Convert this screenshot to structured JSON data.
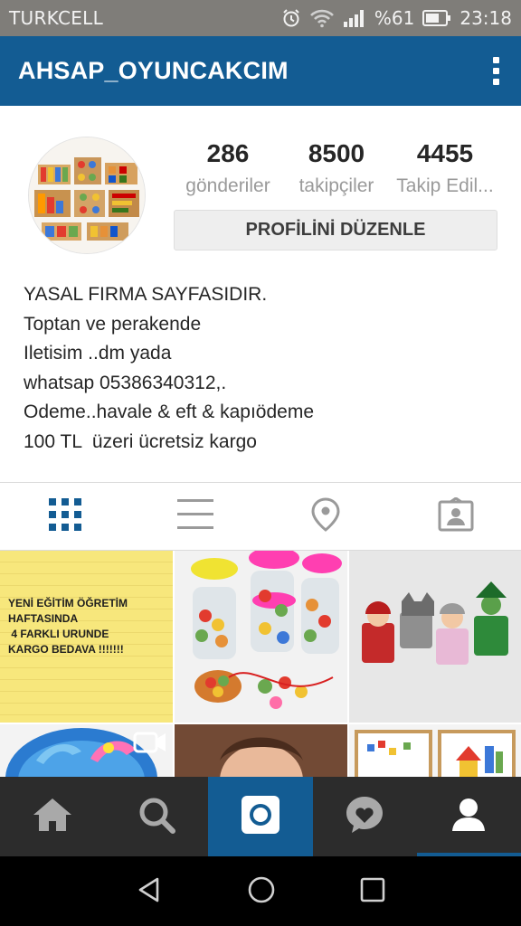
{
  "status_bar": {
    "carrier": "TURKCELL",
    "battery": "%61",
    "time": "23:18",
    "icons": [
      "alarm-icon",
      "wifi-icon",
      "signal-icon",
      "battery-icon"
    ]
  },
  "app_bar": {
    "title": "AHSAP_OYUNCAKCIM",
    "menu_icon": "more-vert-icon"
  },
  "profile": {
    "stats": [
      {
        "value": "286",
        "label": "gönderiler"
      },
      {
        "value": "8500",
        "label": "takipçiler"
      },
      {
        "value": "4455",
        "label": "Takip Edil..."
      }
    ],
    "edit_button": "PROFİLİNİ DÜZENLE",
    "bio_lines": [
      "YASAL FIRMA SAYFASIDIR.",
      "Toptan ve perakende",
      "Iletisim ..dm yada",
      "whatsap 05386340312,.",
      "Odeme..havale & eft & kapıödeme",
      "100 TL  üzeri ücretsiz kargo"
    ]
  },
  "view_tabs": [
    "grid-icon",
    "list-icon",
    "location-pin-icon",
    "tagged-photos-icon"
  ],
  "posts": [
    {
      "type": "text",
      "text": "YENİ EĞİTİM ÖĞRETİM\nHAFTASINDA\n 4 FARKLI URUNDE\nKARGO BEDAVA !!!!!!!"
    },
    {
      "type": "image"
    },
    {
      "type": "image"
    },
    {
      "type": "video"
    },
    {
      "type": "image"
    },
    {
      "type": "image"
    }
  ],
  "bottom_nav": [
    "home-icon",
    "search-icon",
    "camera-icon",
    "activity-heart-icon",
    "profile-icon"
  ],
  "colors": {
    "brand_blue": "#135c93",
    "bottom_nav_bg": "#2c2c2c",
    "status_bar_bg": "#7f7d79"
  }
}
